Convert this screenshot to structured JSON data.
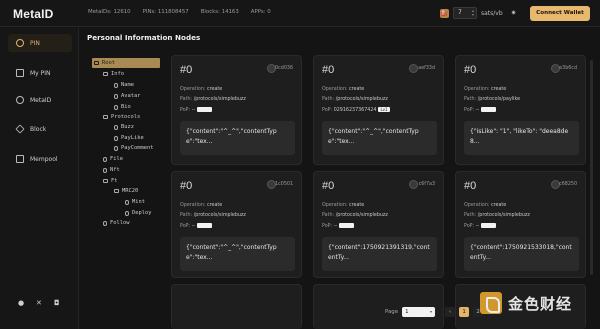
{
  "app": {
    "logo": "MetaID"
  },
  "header": {
    "stats": [
      "MetaIDs: 12610",
      "PINs: 111808457",
      "Blocks: 14163",
      "APPs: 0"
    ],
    "fee_value": "7",
    "fee_unit": "sats/vb",
    "connect_label": "Connect Wallet",
    "accent": "#e9b86f"
  },
  "sidebar": {
    "items": [
      {
        "label": "PIN",
        "icon": "pin-icon",
        "active": true
      },
      {
        "label": "My PIN",
        "icon": "grid-icon",
        "active": false
      },
      {
        "label": "MetaID",
        "icon": "metaid-icon",
        "active": false
      },
      {
        "label": "Block",
        "icon": "block-icon",
        "active": false
      },
      {
        "label": "Mempool",
        "icon": "mempool-icon",
        "active": false
      }
    ],
    "socials": [
      "github-icon",
      "x-icon",
      "discord-icon"
    ]
  },
  "main": {
    "title": "Personal Information Nodes",
    "tree": [
      {
        "label": "Root",
        "selected": true
      },
      {
        "label": "Info"
      },
      {
        "label": "Name"
      },
      {
        "label": "Avatar"
      },
      {
        "label": "Bio"
      },
      {
        "label": "Protocols"
      },
      {
        "label": "Buzz"
      },
      {
        "label": "PayLike"
      },
      {
        "label": "PayComment"
      },
      {
        "label": "File"
      },
      {
        "label": "Nft"
      },
      {
        "label": "Ft"
      },
      {
        "label": "MRC20"
      },
      {
        "label": "Mint"
      },
      {
        "label": "Deploy"
      },
      {
        "label": "Follow"
      }
    ],
    "cards": [
      {
        "id": "#0",
        "addr": "0cd036",
        "operation": "create",
        "path": "/protocols/simplebuzz",
        "pop": "--",
        "pop_tag": "",
        "content": "{\"content\":\"^_^\",\"contentType\":\"tex..."
      },
      {
        "id": "#0",
        "addr": "aef33d",
        "operation": "create",
        "path": "/protocols/simplebuzz",
        "pop": "02916237367424",
        "pop_tag": "Lv1",
        "content": "{\"content\":\"^_^\",\"contentType\":\"tex..."
      },
      {
        "id": "#0",
        "addr": "e3b6cd",
        "operation": "create",
        "path": "/protocols/paylike",
        "pop": "--",
        "pop_tag": "",
        "content": "{\"isLike\": \"1\", \"likeTo\": \"deea8de8..."
      },
      {
        "id": "#0",
        "addr": "1c0501",
        "operation": "create",
        "path": "/protocols/simplebuzz",
        "pop": "--",
        "pop_tag": "",
        "content": "{\"content\":\"^_^\",\"contentType\":\"tex..."
      },
      {
        "id": "#0",
        "addr": "c6f7a3",
        "operation": "create",
        "path": "/protocols/simplebuzz",
        "pop": "--",
        "pop_tag": "",
        "content": "{\"content\":1750921391319,\"contentTy..."
      },
      {
        "id": "#0",
        "addr": "c68250",
        "operation": "create",
        "path": "/protocols/simplebuzz",
        "pop": "--",
        "pop_tag": "",
        "content": "{\"content\":1750921533018,\"contentTy..."
      }
    ],
    "labels": {
      "operation": "Operation:",
      "path": "Path:",
      "pop": "PoP:"
    }
  },
  "pagination": {
    "label": "Page",
    "page_value": "1",
    "pages": [
      "1",
      "2"
    ],
    "current": "1"
  },
  "watermark": {
    "text": "金色财经"
  }
}
